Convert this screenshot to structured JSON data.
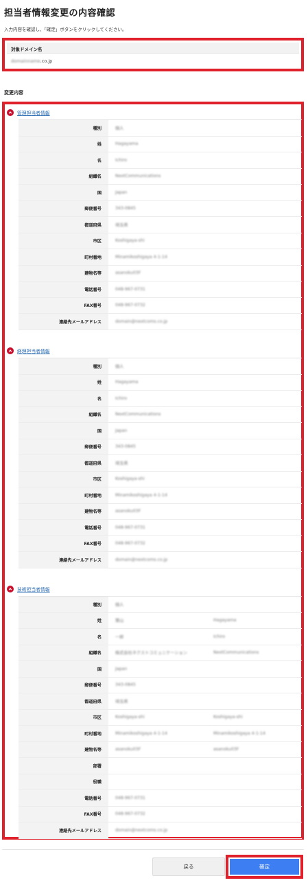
{
  "page": {
    "title": "担当者情報変更の内容確認",
    "instruction": "入力内容を確認し、「確定」ボタンをクリックしてください。"
  },
  "domain": {
    "label": "対象ドメイン名",
    "value_hidden": "domainname",
    "value_suffix": ".co.jp"
  },
  "changes": {
    "heading": "変更内容",
    "sections": [
      {
        "title": "管理担当者情報",
        "rows": [
          {
            "label": "種別",
            "v1": "個人",
            "v2": ""
          },
          {
            "label": "姓",
            "v1": "Hagayama",
            "v2": ""
          },
          {
            "label": "名",
            "v1": "Ichiro",
            "v2": ""
          },
          {
            "label": "組織名",
            "v1": "NextCommunications",
            "v2": ""
          },
          {
            "label": "国",
            "v1": "Japan",
            "v2": ""
          },
          {
            "label": "郵便番号",
            "v1": "343-0845",
            "v2": ""
          },
          {
            "label": "都道府県",
            "v1": "埼玉県",
            "v2": ""
          },
          {
            "label": "市区",
            "v1": "Koshigaya-shi",
            "v2": ""
          },
          {
            "label": "町村番地",
            "v1": "Minamikoshigaya 4-1-14",
            "v2": ""
          },
          {
            "label": "建物名等",
            "v1": "asanoku03F",
            "v2": ""
          },
          {
            "label": "電話番号",
            "v1": "048-967-0731",
            "v2": ""
          },
          {
            "label": "FAX番号",
            "v1": "048-967-0732",
            "v2": ""
          },
          {
            "label": "連絡先メールアドレス",
            "v1": "domain@nextcoms.co.jp",
            "v2": ""
          }
        ]
      },
      {
        "title": "経理担当者情報",
        "rows": [
          {
            "label": "種別",
            "v1": "個人",
            "v2": ""
          },
          {
            "label": "姓",
            "v1": "Hagayama",
            "v2": ""
          },
          {
            "label": "名",
            "v1": "Ichiro",
            "v2": ""
          },
          {
            "label": "組織名",
            "v1": "NextCommunications",
            "v2": ""
          },
          {
            "label": "国",
            "v1": "Japan",
            "v2": ""
          },
          {
            "label": "郵便番号",
            "v1": "343-0845",
            "v2": ""
          },
          {
            "label": "都道府県",
            "v1": "埼玉県",
            "v2": ""
          },
          {
            "label": "市区",
            "v1": "Koshigaya-shi",
            "v2": ""
          },
          {
            "label": "町村番地",
            "v1": "Minamikoshigaya 4-1-14",
            "v2": ""
          },
          {
            "label": "建物名等",
            "v1": "asanoku03F",
            "v2": ""
          },
          {
            "label": "電話番号",
            "v1": "048-967-0731",
            "v2": ""
          },
          {
            "label": "FAX番号",
            "v1": "048-967-0732",
            "v2": ""
          },
          {
            "label": "連絡先メールアドレス",
            "v1": "domain@nextcoms.co.jp",
            "v2": ""
          }
        ]
      },
      {
        "title": "技術担当者情報",
        "rows": [
          {
            "label": "種別",
            "v1": "個人",
            "v2": ""
          },
          {
            "label": "姓",
            "v1": "葉山",
            "v2": "Hagayama"
          },
          {
            "label": "名",
            "v1": "一郎",
            "v2": "Ichiro"
          },
          {
            "label": "組織名",
            "v1": "株式会社ネクストコミュニケーション",
            "v2": "NextCommunications"
          },
          {
            "label": "国",
            "v1": "Japan",
            "v2": ""
          },
          {
            "label": "郵便番号",
            "v1": "343-0845",
            "v2": ""
          },
          {
            "label": "都道府県",
            "v1": "埼玉県",
            "v2": ""
          },
          {
            "label": "市区",
            "v1": "Koshigaya-shi",
            "v2": "Koshigaya-shi"
          },
          {
            "label": "町村番地",
            "v1": "Minamikoshigaya 4-1-14",
            "v2": "Minamikoshigaya 4-1-14"
          },
          {
            "label": "建物名等",
            "v1": "asanoku03F",
            "v2": "asanoku03F"
          },
          {
            "label": "部署",
            "v1": "",
            "v2": ""
          },
          {
            "label": "役職",
            "v1": "",
            "v2": ""
          },
          {
            "label": "電話番号",
            "v1": "048-967-0731",
            "v2": ""
          },
          {
            "label": "FAX番号",
            "v1": "048-967-0732",
            "v2": ""
          },
          {
            "label": "連絡先メールアドレス",
            "v1": "domain@nextcoms.co.jp",
            "v2": ""
          }
        ]
      }
    ]
  },
  "buttons": {
    "back": "戻る",
    "confirm": "確定"
  },
  "colors": {
    "highlight": "#e0202a",
    "link": "#2f6fb5",
    "confirm": "#3d7ff2",
    "chevron": "#c8102e"
  }
}
